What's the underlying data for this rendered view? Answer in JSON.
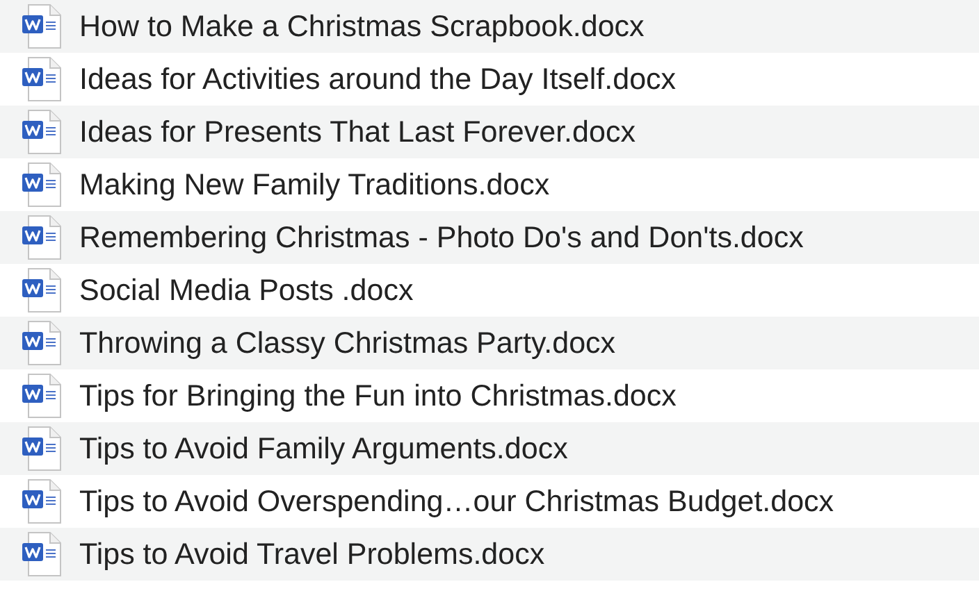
{
  "files": [
    {
      "name": "How to Make a Christmas Scrapbook.docx"
    },
    {
      "name": "Ideas for Activities around the Day Itself.docx"
    },
    {
      "name": "Ideas for Presents That Last Forever.docx"
    },
    {
      "name": "Making New Family Traditions.docx"
    },
    {
      "name": "Remembering Christmas - Photo Do's and Don'ts.docx"
    },
    {
      "name": "Social Media Posts .docx"
    },
    {
      "name": "Throwing a Classy Christmas Party.docx"
    },
    {
      "name": "Tips for Bringing the Fun into Christmas.docx"
    },
    {
      "name": "Tips to Avoid Family Arguments.docx"
    },
    {
      "name": "Tips to Avoid Overspending…our Christmas Budget.docx"
    },
    {
      "name": "Tips to Avoid Travel Problems.docx"
    }
  ]
}
